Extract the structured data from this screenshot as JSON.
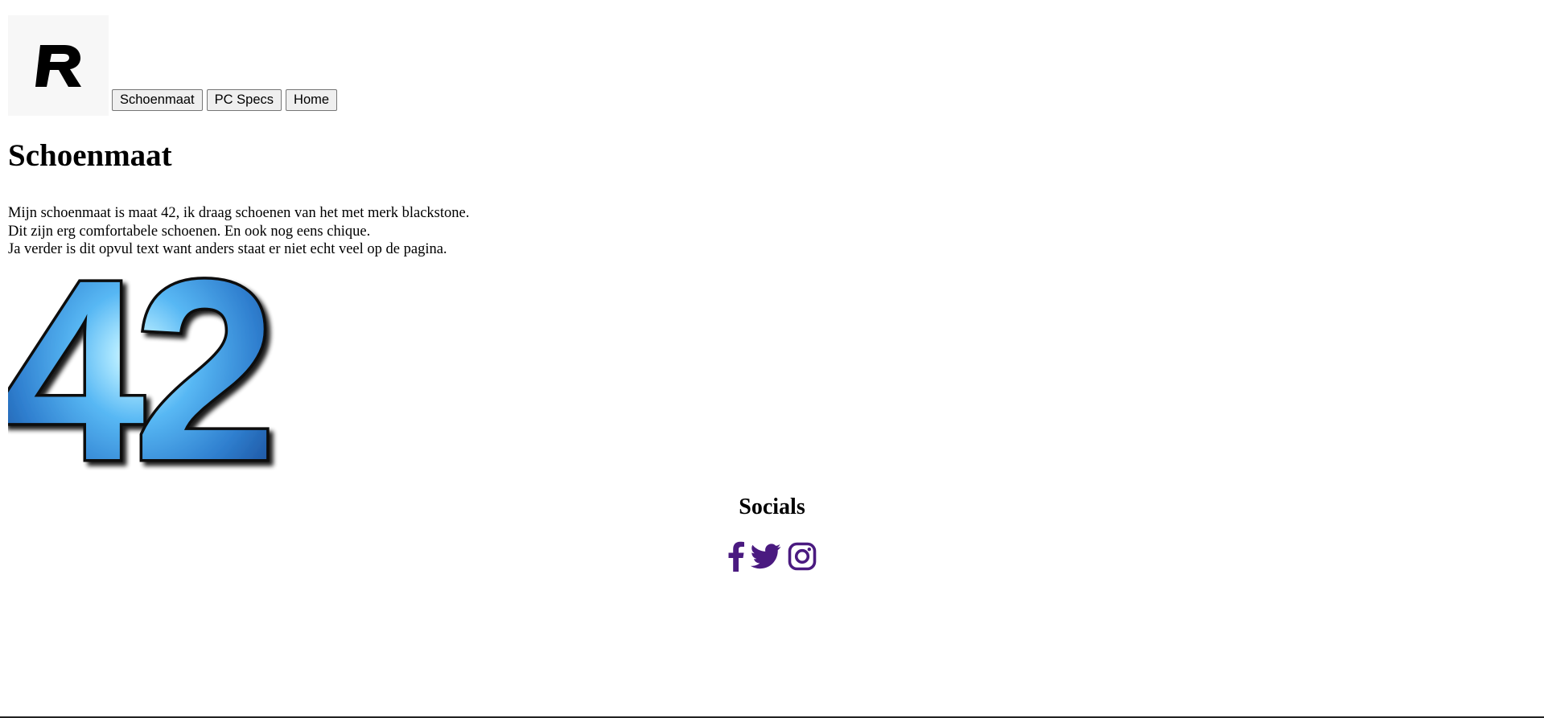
{
  "nav": {
    "logo_icon": "r-logo-icon",
    "buttons": [
      "Schoenmaat",
      "PC Specs",
      "Home"
    ]
  },
  "main": {
    "title": "Schoenmaat",
    "lines": [
      "Mijn schoenmaat is maat 42, ik draag schoenen van het met merk blackstone.",
      "Dit zijn erg comfortabele schoenen. En ook nog eens chique.",
      "Ja verder is dit opvul text want anders staat er niet echt veel op de pagina."
    ],
    "size_image_text": "42"
  },
  "socials": {
    "title": "Socials",
    "icons": [
      "facebook-icon",
      "twitter-icon",
      "instagram-icon"
    ],
    "icon_color": "#4a1a80"
  }
}
